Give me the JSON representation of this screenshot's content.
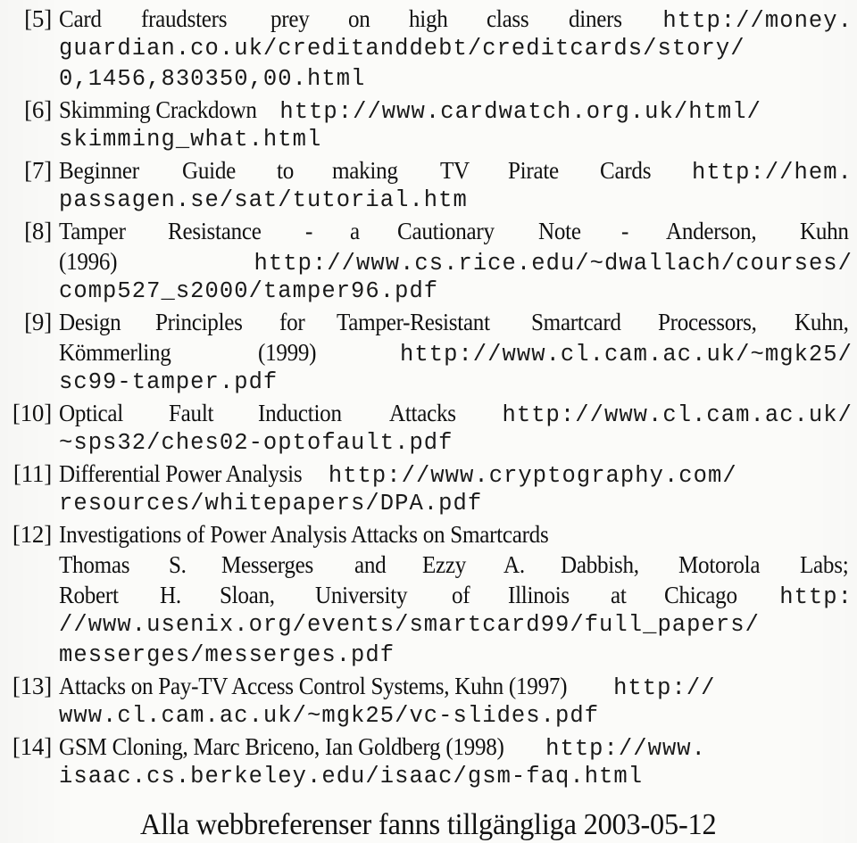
{
  "document": {
    "type": "bibliography-reference-list",
    "background_color": "#fbfbf9",
    "text_color": "#111111",
    "closing_note": "Alla webbreferenser fanns tillgängliga 2003-05-12"
  },
  "references": [
    {
      "marker": "[5]",
      "title": "Card fraudsters prey on high class diners",
      "url": "http://money.guardian.co.uk/creditanddebt/creditcards/story/0,1456,830350,00.html",
      "lines": [
        {
          "justify": true,
          "parts": [
            {
              "style": "serif",
              "text": "Card"
            },
            {
              "style": "serif",
              "text": "fraudsters"
            },
            {
              "style": "serif",
              "text": "prey"
            },
            {
              "style": "serif",
              "text": "on"
            },
            {
              "style": "serif",
              "text": "high"
            },
            {
              "style": "serif",
              "text": "class"
            },
            {
              "style": "serif",
              "text": "diners"
            },
            {
              "style": "mono",
              "text": "http://money."
            }
          ]
        },
        {
          "justify": false,
          "parts": [
            {
              "style": "mono",
              "text": "guardian.co.uk/creditanddebt/creditcards/story/"
            }
          ]
        },
        {
          "justify": false,
          "parts": [
            {
              "style": "mono",
              "text": "0,1456,830350,00.html"
            }
          ]
        }
      ]
    },
    {
      "marker": "[6]",
      "title": "Skimming Crackdown",
      "url": "http://www.cardwatch.org.uk/html/skimming_what.html",
      "lines": [
        {
          "justify": false,
          "parts": [
            {
              "style": "serif",
              "text": "Skimming Crackdown"
            },
            {
              "style": "mono",
              "text": "http://www.cardwatch.org.uk/html/"
            }
          ]
        },
        {
          "justify": false,
          "parts": [
            {
              "style": "mono",
              "text": "skimming_what.html"
            }
          ]
        }
      ]
    },
    {
      "marker": "[7]",
      "title": "Beginner Guide to making TV Pirate Cards",
      "url": "http://hem.passagen.se/sat/tutorial.htm",
      "lines": [
        {
          "justify": true,
          "parts": [
            {
              "style": "serif",
              "text": "Beginner"
            },
            {
              "style": "serif",
              "text": "Guide"
            },
            {
              "style": "serif",
              "text": "to"
            },
            {
              "style": "serif",
              "text": "making"
            },
            {
              "style": "serif",
              "text": "TV"
            },
            {
              "style": "serif",
              "text": "Pirate"
            },
            {
              "style": "serif",
              "text": "Cards"
            },
            {
              "style": "mono",
              "text": "http://hem."
            }
          ]
        },
        {
          "justify": false,
          "parts": [
            {
              "style": "mono",
              "text": "passagen.se/sat/tutorial.htm"
            }
          ]
        }
      ]
    },
    {
      "marker": "[8]",
      "title": "Tamper Resistance - a Cautionary Note - Anderson, Kuhn (1996)",
      "url": "http://www.cs.rice.edu/~dwallach/courses/comp527_s2000/tamper96.pdf",
      "lines": [
        {
          "justify": true,
          "parts": [
            {
              "style": "serif",
              "text": "Tamper"
            },
            {
              "style": "serif",
              "text": "Resistance"
            },
            {
              "style": "serif",
              "text": "-"
            },
            {
              "style": "serif",
              "text": "a"
            },
            {
              "style": "serif",
              "text": "Cautionary"
            },
            {
              "style": "serif",
              "text": "Note"
            },
            {
              "style": "serif",
              "text": "-"
            },
            {
              "style": "serif",
              "text": "Anderson,"
            },
            {
              "style": "serif",
              "text": "Kuhn"
            }
          ]
        },
        {
          "justify": true,
          "parts": [
            {
              "style": "serif",
              "text": "(1996)"
            },
            {
              "style": "mono",
              "text": "http://www.cs.rice.edu/~dwallach/courses/"
            }
          ]
        },
        {
          "justify": false,
          "parts": [
            {
              "style": "mono",
              "text": "comp527_s2000/tamper96.pdf"
            }
          ]
        }
      ]
    },
    {
      "marker": "[9]",
      "title": "Design Principles for Tamper-Resistant Smartcard Processors, Kuhn, Kömmerling (1999)",
      "url": "http://www.cl.cam.ac.uk/~mgk25/sc99-tamper.pdf",
      "lines": [
        {
          "justify": true,
          "parts": [
            {
              "style": "serif",
              "text": "Design"
            },
            {
              "style": "serif",
              "text": "Principles"
            },
            {
              "style": "serif",
              "text": "for"
            },
            {
              "style": "serif",
              "text": "Tamper-Resistant"
            },
            {
              "style": "serif",
              "text": "Smartcard"
            },
            {
              "style": "serif",
              "text": "Processors,"
            },
            {
              "style": "serif",
              "text": "Kuhn,"
            }
          ]
        },
        {
          "justify": true,
          "parts": [
            {
              "style": "serif",
              "text": "Kömmerling"
            },
            {
              "style": "serif",
              "text": "(1999)"
            },
            {
              "style": "mono",
              "text": "http://www.cl.cam.ac.uk/~mgk25/"
            }
          ]
        },
        {
          "justify": false,
          "parts": [
            {
              "style": "mono",
              "text": "sc99-tamper.pdf"
            }
          ]
        }
      ]
    },
    {
      "marker": "[10]",
      "title": "Optical Fault Induction Attacks",
      "url": "http://www.cl.cam.ac.uk/~sps32/ches02-optofault.pdf",
      "lines": [
        {
          "justify": true,
          "parts": [
            {
              "style": "serif",
              "text": "Optical"
            },
            {
              "style": "serif",
              "text": "Fault"
            },
            {
              "style": "serif",
              "text": "Induction"
            },
            {
              "style": "serif",
              "text": "Attacks"
            },
            {
              "style": "mono",
              "text": "http://www.cl.cam.ac.uk/"
            }
          ]
        },
        {
          "justify": false,
          "parts": [
            {
              "style": "mono",
              "text": "~sps32/ches02-optofault.pdf"
            }
          ]
        }
      ]
    },
    {
      "marker": "[11]",
      "title": "Differential Power Analysis",
      "url": "http://www.cryptography.com/resources/whitepapers/DPA.pdf",
      "lines": [
        {
          "justify": false,
          "parts": [
            {
              "style": "serif",
              "text": "Differential  Power  Analysis"
            },
            {
              "style": "mono",
              "text": "http://www.cryptography.com/"
            }
          ]
        },
        {
          "justify": false,
          "parts": [
            {
              "style": "mono",
              "text": "resources/whitepapers/DPA.pdf"
            }
          ]
        }
      ]
    },
    {
      "marker": "[12]",
      "title": "Investigations of Power Analysis Attacks on Smartcards",
      "authors": "Thomas S. Messerges and Ezzy A. Dabbish, Motorola Labs; Robert H. Sloan, University of Illinois at Chicago",
      "url": "http://www.usenix.org/events/smartcard99/full_papers/messerges/messerges.pdf",
      "lines": [
        {
          "justify": false,
          "parts": [
            {
              "style": "serif",
              "text": "Investigations of Power Analysis Attacks on Smartcards"
            }
          ]
        },
        {
          "justify": true,
          "parts": [
            {
              "style": "serif",
              "text": "Thomas"
            },
            {
              "style": "serif",
              "text": "S."
            },
            {
              "style": "serif",
              "text": "Messerges"
            },
            {
              "style": "serif",
              "text": "and"
            },
            {
              "style": "serif",
              "text": "Ezzy"
            },
            {
              "style": "serif",
              "text": "A."
            },
            {
              "style": "serif",
              "text": "Dabbish,"
            },
            {
              "style": "serif",
              "text": "Motorola"
            },
            {
              "style": "serif",
              "text": "Labs;"
            }
          ]
        },
        {
          "justify": true,
          "parts": [
            {
              "style": "serif",
              "text": "Robert"
            },
            {
              "style": "serif",
              "text": "H."
            },
            {
              "style": "serif",
              "text": "Sloan,"
            },
            {
              "style": "serif",
              "text": "University"
            },
            {
              "style": "serif",
              "text": "of"
            },
            {
              "style": "serif",
              "text": "Illinois"
            },
            {
              "style": "serif",
              "text": "at"
            },
            {
              "style": "serif",
              "text": "Chicago"
            },
            {
              "style": "mono",
              "text": "http:"
            }
          ]
        },
        {
          "justify": false,
          "parts": [
            {
              "style": "mono",
              "text": "//www.usenix.org/events/smartcard99/full_papers/"
            }
          ]
        },
        {
          "justify": false,
          "parts": [
            {
              "style": "mono",
              "text": "messerges/messerges.pdf"
            }
          ]
        }
      ]
    },
    {
      "marker": "[13]",
      "title": "Attacks on Pay-TV Access Control Systems, Kuhn (1997)",
      "url": "http://www.cl.cam.ac.uk/~mgk25/vc-slides.pdf",
      "lines": [
        {
          "justify": false,
          "parts": [
            {
              "style": "serif",
              "text": "Attacks on Pay-TV Access Control Systems, Kuhn (1997)"
            },
            {
              "style": "mono",
              "text": "http://"
            }
          ]
        },
        {
          "justify": false,
          "parts": [
            {
              "style": "mono",
              "text": "www.cl.cam.ac.uk/~mgk25/vc-slides.pdf"
            }
          ]
        }
      ]
    },
    {
      "marker": "[14]",
      "title": "GSM Cloning, Marc Briceno, Ian Goldberg (1998)",
      "url": "http://www.isaac.cs.berkeley.edu/isaac/gsm-faq.html",
      "lines": [
        {
          "justify": false,
          "parts": [
            {
              "style": "serif",
              "text": "GSM Cloning, Marc Briceno, Ian Goldberg (1998)"
            },
            {
              "style": "mono",
              "text": "http://www."
            }
          ]
        },
        {
          "justify": false,
          "parts": [
            {
              "style": "mono",
              "text": "isaac.cs.berkeley.edu/isaac/gsm-faq.html"
            }
          ]
        }
      ]
    }
  ]
}
